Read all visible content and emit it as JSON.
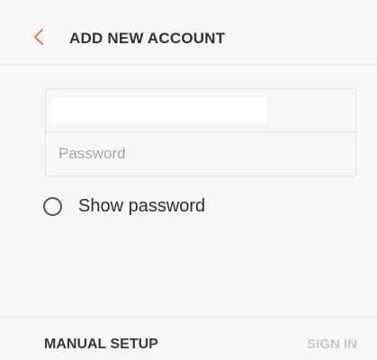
{
  "header": {
    "title": "ADD NEW ACCOUNT",
    "back_icon": "chevron-left-icon",
    "back_icon_color": "#e0825e"
  },
  "form": {
    "email_value": "",
    "password_placeholder": "Password",
    "show_password_label": "Show password",
    "show_password_checked": false
  },
  "footer": {
    "manual_setup_label": "MANUAL SETUP",
    "sign_in_label": "SIGN IN",
    "sign_in_enabled": false
  },
  "colors": {
    "accent": "#e0825e",
    "disabled_text": "#c8c8c8",
    "background": "#f7f7f7"
  }
}
